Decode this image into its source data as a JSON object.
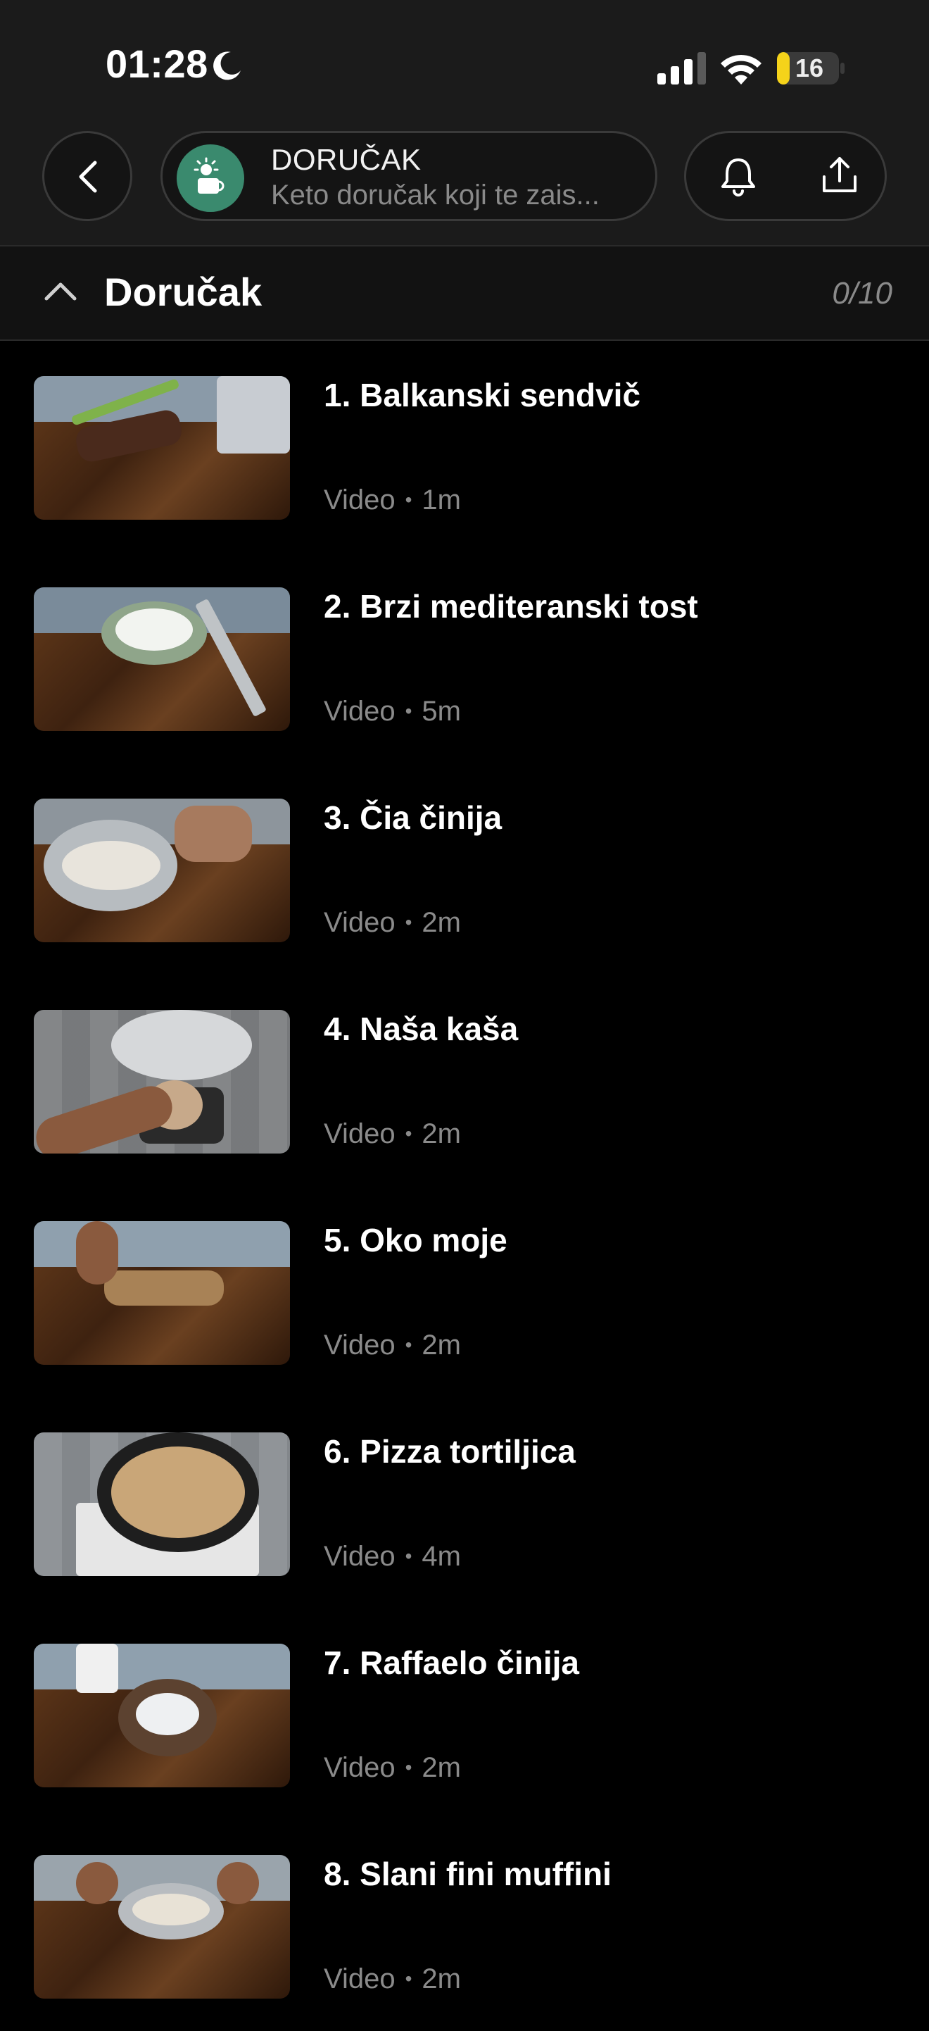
{
  "status_bar": {
    "time": "01:28",
    "battery": "16"
  },
  "header": {
    "course_title": "DORUČAK",
    "course_subtitle": "Keto doručak koji te zais..."
  },
  "section": {
    "title": "Doručak",
    "progress": "0/10"
  },
  "lessons": [
    {
      "title": "1. Balkanski sendvič",
      "type": "Video",
      "separator": "•",
      "duration": "1m"
    },
    {
      "title": "2. Brzi mediteranski tost",
      "type": "Video",
      "separator": "•",
      "duration": "5m"
    },
    {
      "title": "3. Čia činija",
      "type": "Video",
      "separator": "•",
      "duration": "2m"
    },
    {
      "title": "4. Naša kaša",
      "type": "Video",
      "separator": "•",
      "duration": "2m"
    },
    {
      "title": "5. Oko moje",
      "type": "Video",
      "separator": "•",
      "duration": "2m"
    },
    {
      "title": "6. Pizza tortiljica",
      "type": "Video",
      "separator": "•",
      "duration": "4m"
    },
    {
      "title": "7. Raffaelo činija",
      "type": "Video",
      "separator": "•",
      "duration": "2m"
    },
    {
      "title": "8. Slani fini muffini",
      "type": "Video",
      "separator": "•",
      "duration": "2m"
    }
  ],
  "colors": {
    "background": "#000000",
    "header_bg": "#1b1b1b",
    "course_icon_bg": "#3a8a6e",
    "battery": "#f5d31a",
    "muted_text": "#8a8a8a"
  },
  "icons": {
    "status": [
      "moon-icon",
      "signal-icon",
      "wifi-icon",
      "battery-icon"
    ],
    "header": [
      "chevron-left-icon",
      "sun-cup-icon",
      "bell-icon",
      "share-icon"
    ],
    "section": "chevron-up-icon"
  }
}
